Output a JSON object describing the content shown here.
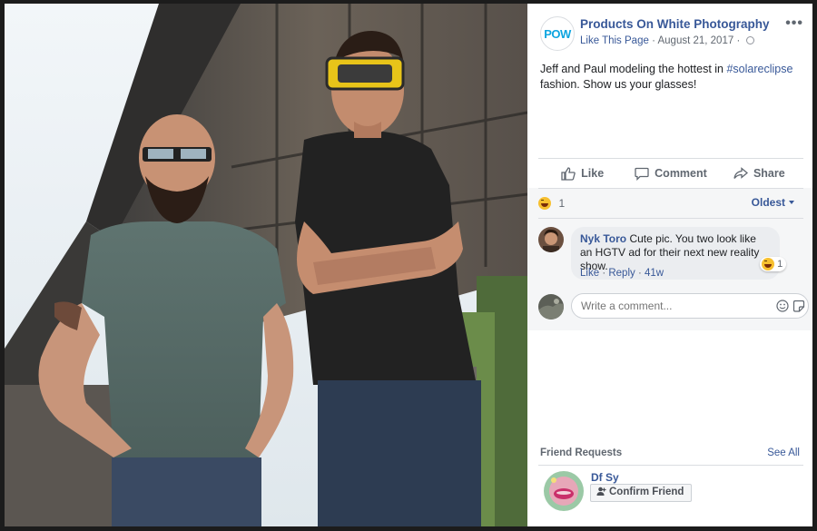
{
  "post": {
    "page_logo": "POW",
    "page_name": "Products On White Photography",
    "like_page": "Like This Page",
    "separator": "·",
    "date": "August 21, 2017",
    "audience_separator": "·",
    "more": "•••",
    "text_before": "Jeff and Paul modeling the hottest in ",
    "hashtag": "#solareclipse",
    "text_after": " fashion. Show us your glasses!"
  },
  "actions": {
    "like": "Like",
    "comment": "Comment",
    "share": "Share"
  },
  "reactions": {
    "count": "1",
    "sort_label": "Oldest"
  },
  "comment": {
    "author": "Nyk Toro",
    "text": " Cute pic. You two look like an HGTV ad for their next new reality show.",
    "reaction_count": "1",
    "like": "Like",
    "reply": "Reply",
    "dot": "·",
    "age": "41w"
  },
  "composer": {
    "placeholder": "Write a comment..."
  },
  "friend_requests": {
    "title": "Friend Requests",
    "see_all": "See All",
    "name": "Df Sy",
    "confirm": "Confirm Friend"
  },
  "icons": [
    "more-icon",
    "globe-icon",
    "like-icon",
    "comment-icon",
    "share-icon",
    "laugh-icon",
    "caret-down-icon",
    "emoji-icon",
    "sticker-icon",
    "add-friend-icon"
  ],
  "colors": {
    "link": "#385898",
    "muted": "#606770",
    "logo": "#0ea5e0",
    "panel_gray": "#f5f6f7"
  }
}
